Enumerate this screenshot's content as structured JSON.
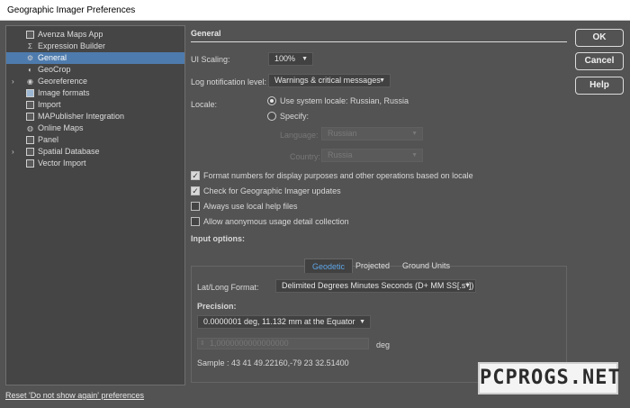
{
  "window": {
    "title": "Geographic Imager Preferences"
  },
  "tree": {
    "items": [
      {
        "label": "Avenza Maps App",
        "icon": "phone-icon",
        "expandable": false,
        "selected": false
      },
      {
        "label": "Expression Builder",
        "icon": "sigma-icon",
        "expandable": false,
        "selected": false
      },
      {
        "label": "General",
        "icon": "gear-icon",
        "expandable": false,
        "selected": true
      },
      {
        "label": "GeoCrop",
        "icon": "crop-icon",
        "expandable": false,
        "selected": false
      },
      {
        "label": "Georeference",
        "icon": "georeference-icon",
        "expandable": true,
        "selected": false
      },
      {
        "label": "Image formats",
        "icon": "image-icon",
        "expandable": false,
        "selected": false
      },
      {
        "label": "Import",
        "icon": "import-icon",
        "expandable": false,
        "selected": false
      },
      {
        "label": "MAPublisher Integration",
        "icon": "mapublisher-icon",
        "expandable": false,
        "selected": false
      },
      {
        "label": "Online Maps",
        "icon": "globe-icon",
        "expandable": false,
        "selected": false
      },
      {
        "label": "Panel",
        "icon": "panel-icon",
        "expandable": false,
        "selected": false
      },
      {
        "label": "Spatial Database",
        "icon": "database-icon",
        "expandable": true,
        "selected": false
      },
      {
        "label": "Vector Import",
        "icon": "vector-icon",
        "expandable": false,
        "selected": false
      }
    ]
  },
  "reset_link": "Reset 'Do not show again' preferences",
  "general": {
    "title": "General",
    "ui_scaling": {
      "label": "UI Scaling:",
      "value": "100%"
    },
    "log_level": {
      "label": "Log notification level:",
      "value": "Warnings & critical messages"
    },
    "locale": {
      "label": "Locale:",
      "system_option": "Use system locale: Russian, Russia",
      "specify_option": "Specify:",
      "language_label": "Language:",
      "language_value": "Russian",
      "country_label": "Country:",
      "country_value": "Russia"
    },
    "checks": [
      {
        "label": "Format numbers for display purposes and other operations based on locale",
        "checked": true
      },
      {
        "label": "Check for Geographic Imager updates",
        "checked": true
      },
      {
        "label": "Always use local help files",
        "checked": false
      },
      {
        "label": "Allow anonymous usage detail collection",
        "checked": false
      }
    ],
    "input_options_label": "Input options:"
  },
  "input": {
    "tabs": [
      "Geodetic",
      "Projected",
      "Ground Units"
    ],
    "latlong_label": "Lat/Long Format:",
    "latlong_value": "Delimited Degrees Minutes Seconds (D+ MM SS[.s*])",
    "precision_label": "Precision:",
    "precision_value": "0.0000001 deg, 11.132 mm at the Equator",
    "precision_input": "1,0000000000000000",
    "unit": "deg",
    "sample": "Sample : 43 41 49.22160,-79 23 32.51400"
  },
  "buttons": {
    "ok": "OK",
    "cancel": "Cancel",
    "help": "Help"
  },
  "watermark": "PCPROGS.NET",
  "colors": {
    "background": "#535353",
    "selection": "#4e7bad",
    "active_tab": "#5ea6e8"
  }
}
